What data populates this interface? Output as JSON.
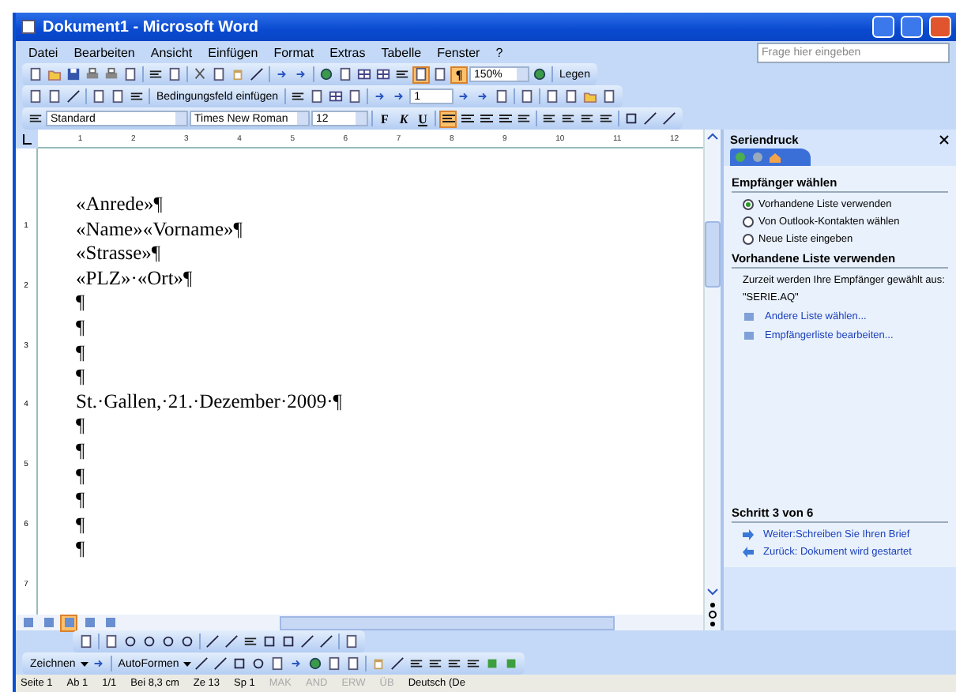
{
  "window": {
    "title": "Dokument1 - Microsoft Word"
  },
  "menu": [
    "Datei",
    "Bearbeiten",
    "Ansicht",
    "Einfügen",
    "Format",
    "Extras",
    "Tabelle",
    "Fenster",
    "?"
  ],
  "help": {
    "placeholder": "Frage hier eingeben"
  },
  "standard_toolbar": {
    "layout_pressed": true,
    "show_all": {
      "label": "¶",
      "selected": true
    },
    "zoom": "150%",
    "read_button": "Legen"
  },
  "mailmerge_toolbar": {
    "insert_field": "Bedingungsfeld einfügen",
    "record": "1"
  },
  "formatting_toolbar": {
    "style": "Standard",
    "font": "Times New Roman",
    "size": "12",
    "bold": "F",
    "italic": "K",
    "underline": "U",
    "align": [
      {
        "selected": true
      },
      {
        "selected": false
      },
      {
        "selected": false
      },
      {
        "selected": false
      }
    ]
  },
  "ruler": [
    "1",
    "2",
    "3",
    "4",
    "5",
    "6",
    "7",
    "8",
    "9",
    "10",
    "11",
    "12"
  ],
  "vertical_ruler": [
    "1",
    "2",
    "3",
    "4",
    "5",
    "6",
    "7"
  ],
  "document": {
    "lines": [
      "«Anrede»¶",
      "«Name»«Vorname»¶",
      "«Strasse»¶",
      "«PLZ»·«Ort»¶",
      "¶",
      "¶",
      "¶",
      "¶",
      "St.·Gallen,·21.·Dezember·2009·¶",
      "¶",
      "¶",
      "¶",
      "¶",
      "¶",
      "¶"
    ]
  },
  "view_buttons": [
    {
      "selected": false
    },
    {
      "selected": false
    },
    {
      "selected": true
    },
    {
      "selected": false
    },
    {
      "selected": false
    }
  ],
  "task_pane": {
    "title": "Seriendruck",
    "sections": [
      {
        "heading": "Empfänger wählen",
        "options": [
          {
            "label": "Vorhandene Liste verwenden",
            "selected": true
          },
          {
            "label": "Von Outlook-Kontakten wählen",
            "selected": false
          },
          {
            "label": "Neue Liste eingeben",
            "selected": false
          }
        ]
      },
      {
        "heading": "Vorhandene Liste verwenden",
        "text": "Zurzeit werden Ihre Empfänger gewählt aus:",
        "source": "\"SERIE.AQ\"",
        "links": [
          "Andere Liste wählen...",
          "Empfängerliste bearbeiten..."
        ]
      }
    ],
    "step": {
      "heading": "Schritt 3 von 6",
      "next": "Weiter:Schreiben Sie Ihren Brief",
      "back": "Zurück: Dokument wird gestartet"
    }
  },
  "drawing_toolbar": {
    "draw": "Zeichnen",
    "autoshapes": "AutoFormen"
  },
  "status_bar": [
    {
      "text": "Seite 1",
      "disabled": false
    },
    {
      "text": "Ab 1",
      "disabled": false
    },
    {
      "text": "1/1",
      "disabled": false
    },
    {
      "text": "Bei 8,3 cm",
      "disabled": false
    },
    {
      "text": "Ze 13",
      "disabled": false
    },
    {
      "text": "Sp 1",
      "disabled": false
    },
    {
      "text": "MAK",
      "disabled": true
    },
    {
      "text": "AND",
      "disabled": true
    },
    {
      "text": "ERW",
      "disabled": true
    },
    {
      "text": "ÜB",
      "disabled": true
    },
    {
      "text": "Deutsch (De",
      "disabled": false
    }
  ]
}
